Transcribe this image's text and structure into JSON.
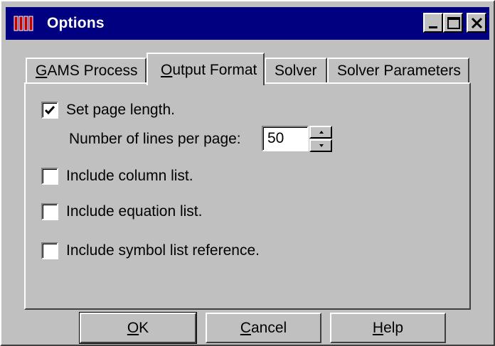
{
  "window": {
    "title": "Options",
    "title_bar_color": "#000080",
    "face_color": "#c0c0c0",
    "controls": [
      "minimize-icon",
      "maximize-icon",
      "close-icon"
    ]
  },
  "tabs": [
    {
      "label": "GAMS Process",
      "mnemonic": "G",
      "rest": "AMS Process",
      "active": false
    },
    {
      "label": "Output Format",
      "mnemonic": "O",
      "rest": "utput Format",
      "active": true
    },
    {
      "label": "Solver",
      "active": false
    },
    {
      "label": "Solver Parameters",
      "active": false
    }
  ],
  "options": {
    "set_page_length": {
      "label": "Set page length.",
      "checked": true
    },
    "lines_per_page": {
      "label": "Number of lines per page:",
      "value": "50"
    },
    "include_column_list": {
      "label": "Include column list.",
      "checked": false
    },
    "include_equation_list": {
      "label": "Include equation list.",
      "checked": false
    },
    "include_symbol_list": {
      "label": "Include symbol list reference.",
      "checked": false
    }
  },
  "buttons": {
    "ok": {
      "label": "OK",
      "mnemonic": "O",
      "rest": "K"
    },
    "cancel": {
      "label": "Cancel",
      "mnemonic": "C",
      "rest": "ancel"
    },
    "help": {
      "label": "Help",
      "mnemonic": "H",
      "rest": "elp"
    }
  }
}
